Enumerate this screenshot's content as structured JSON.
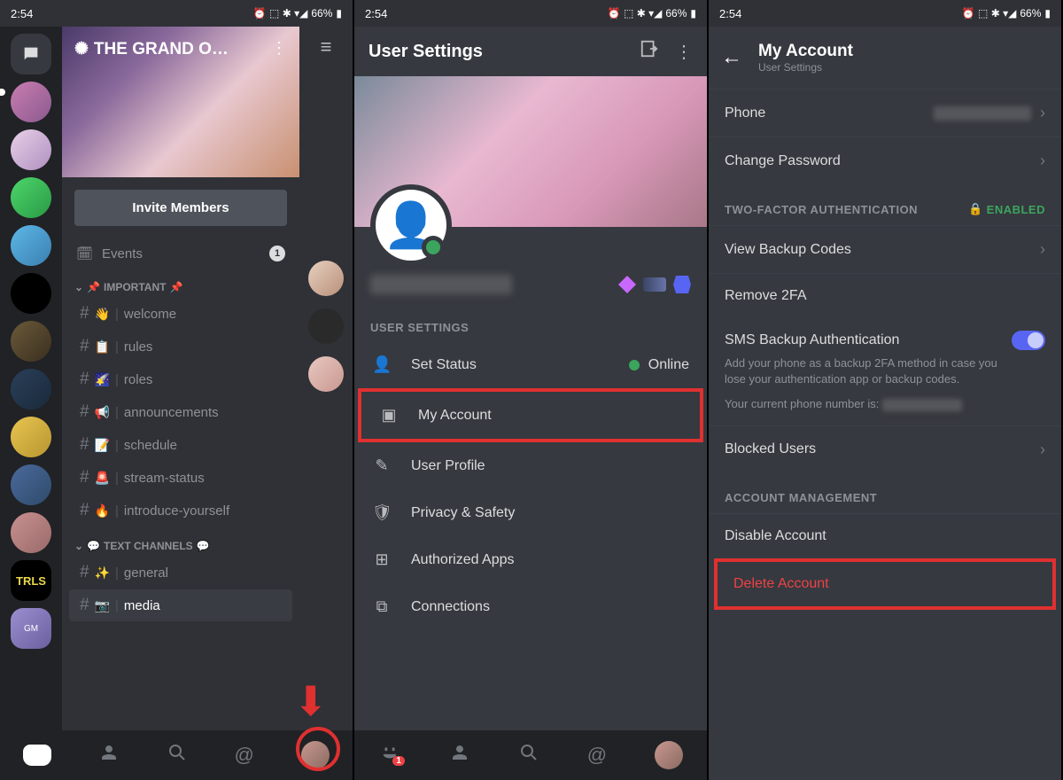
{
  "status_bar": {
    "time": "2:54",
    "battery": "66%",
    "icons": "⏰ ⬚ ✱ ▾◢"
  },
  "panel1": {
    "server_name": "THE GRAND O…",
    "invite_button": "Invite Members",
    "events_label": "Events",
    "events_count": "1",
    "categories": [
      {
        "name": "IMPORTANT",
        "prefix": "📌",
        "suffix": "📌"
      },
      {
        "name": "TEXT CHANNELS",
        "prefix": "💬",
        "suffix": "💬"
      }
    ],
    "channels_important": [
      {
        "emoji": "👋",
        "name": "welcome"
      },
      {
        "emoji": "📋",
        "name": "rules"
      },
      {
        "emoji": "🌠",
        "name": "roles"
      },
      {
        "emoji": "📢",
        "name": "announcements"
      },
      {
        "emoji": "📝",
        "name": "schedule"
      },
      {
        "emoji": "🚨",
        "name": "stream-status"
      },
      {
        "emoji": "🔥",
        "name": "introduce-yourself"
      }
    ],
    "channels_text": [
      {
        "emoji": "✨",
        "name": "general"
      },
      {
        "emoji": "📷",
        "name": "media",
        "active": true
      }
    ],
    "server_icons": [
      "msg",
      "c1",
      "c2",
      "c3",
      "c4",
      "c5",
      "c6",
      "c7",
      "c8",
      "c9",
      "c10",
      "trls",
      "gm"
    ],
    "trls_label": "TRLS",
    "gm_label": "GM"
  },
  "panel2": {
    "title": "User Settings",
    "section_label": "USER SETTINGS",
    "status_online": "Online",
    "rows": [
      {
        "icon": "👤",
        "label": "Set Status",
        "status": true
      },
      {
        "icon": "▣",
        "label": "My Account",
        "highlight": true
      },
      {
        "icon": "✎",
        "label": "User Profile"
      },
      {
        "icon": "🛡",
        "label": "Privacy & Safety"
      },
      {
        "icon": "⊞",
        "label": "Authorized Apps"
      },
      {
        "icon": "⧉",
        "label": "Connections"
      }
    ]
  },
  "panel3": {
    "title": "My Account",
    "subtitle": "User Settings",
    "phone_label": "Phone",
    "change_password": "Change Password",
    "tfa_header": "TWO-FACTOR AUTHENTICATION",
    "enabled_label": "ENABLED",
    "view_backup": "View Backup Codes",
    "remove_2fa": "Remove 2FA",
    "sms_title": "SMS Backup Authentication",
    "sms_desc": "Add your phone as a backup 2FA method in case you lose your authentication app or backup codes.",
    "phone_current": "Your current phone number is:",
    "blocked_users": "Blocked Users",
    "account_mgmt": "ACCOUNT MANAGEMENT",
    "disable_account": "Disable Account",
    "delete_account": "Delete Account"
  }
}
